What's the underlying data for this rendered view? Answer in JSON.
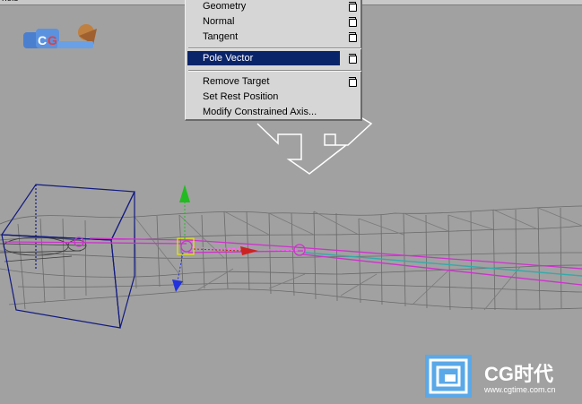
{
  "topbar": {
    "label": "nels"
  },
  "menu": {
    "items": [
      {
        "label": "Geometry",
        "has_option": true
      },
      {
        "label": "Normal",
        "has_option": true
      },
      {
        "label": "Tangent",
        "has_option": true
      },
      {
        "label": "Pole Vector",
        "has_option": true,
        "selected": true
      },
      {
        "label": "Remove Target",
        "has_option": true
      },
      {
        "label": "Set Rest Position",
        "has_option": false
      },
      {
        "label": "Modify Constrained Axis...",
        "has_option": false
      }
    ]
  },
  "watermark": {
    "brand": "CG时代",
    "url": "www.cgtime.com.cn"
  },
  "colors": {
    "viewport_bg": "#a1a1a1",
    "menu_bg": "#d6d6d6",
    "menu_selection": "#0a246a",
    "wireframe": "#6a6a6a",
    "bone": "#cc33cc",
    "manipulator_box": "#111a80",
    "y_axis": "#22bb22",
    "z_axis": "#2233dd",
    "pole_vector_arrow": "#cc2222"
  },
  "icons": [
    "cg-logo-icon",
    "move-manipulator-icon",
    "cgtime-watermark-icon",
    "option-box-icon"
  ]
}
